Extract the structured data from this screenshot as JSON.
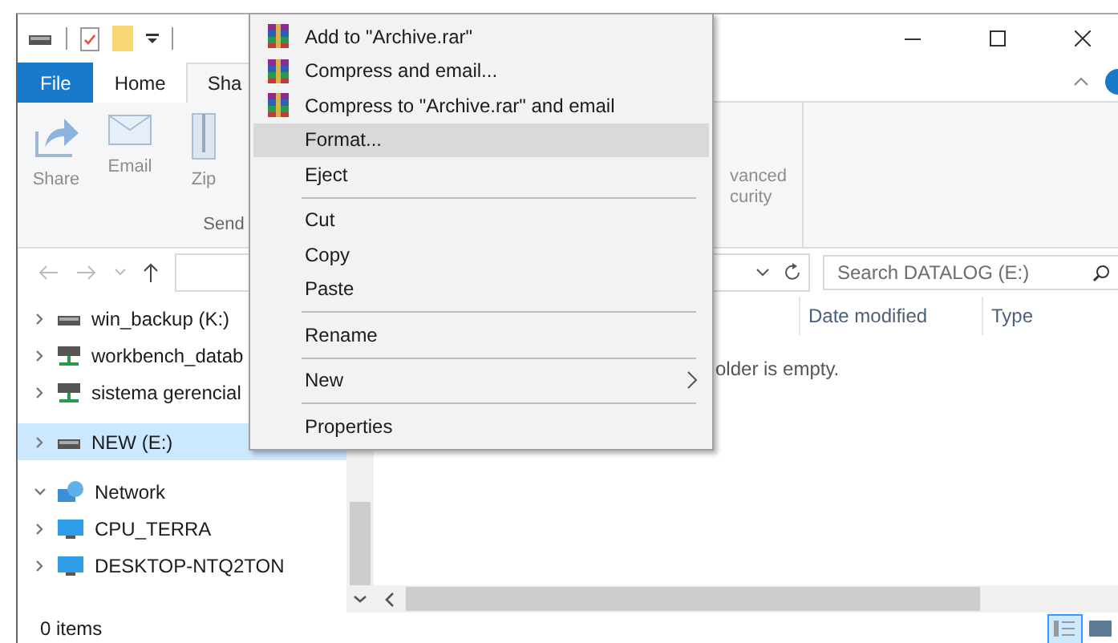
{
  "tabs": [
    {
      "label": "File",
      "kind": "file",
      "selected": false
    },
    {
      "label": "Home",
      "kind": "tab",
      "selected": false
    },
    {
      "label": "Sha",
      "kind": "tab",
      "selected": true
    }
  ],
  "ribbon": {
    "send_group": {
      "label": "Send",
      "buttons": [
        {
          "label": "Share",
          "kind": "share",
          "disabled": true
        },
        {
          "label": "Email",
          "kind": "email",
          "disabled": true
        },
        {
          "label": "Zip",
          "kind": "zip",
          "disabled": true
        }
      ]
    },
    "security_button": {
      "lines": [
        "vanced",
        "curity"
      ]
    }
  },
  "address_bar": {
    "search_placeholder": "Search DATALOG (E:)"
  },
  "navigation": [
    {
      "items": [
        {
          "label": "win_backup (K:)",
          "kind": "drive",
          "selected": false
        },
        {
          "label": "workbench_datab",
          "kind": "netdrive",
          "selected": false
        },
        {
          "label": "sistema gerencial",
          "kind": "netdrive",
          "selected": false
        }
      ]
    },
    {
      "items": [
        {
          "label": "NEW (E:)",
          "kind": "drive",
          "selected": true
        }
      ]
    },
    {
      "items": [
        {
          "label": "Network",
          "kind": "network",
          "selected": false,
          "expanded": true,
          "children": [
            {
              "label": "CPU_TERRA",
              "kind": "computer",
              "selected": false
            },
            {
              "label": "DESKTOP-NTQ2TON",
              "kind": "computer",
              "selected": false
            }
          ]
        }
      ]
    }
  ],
  "columns": [
    "Date modified",
    "Type"
  ],
  "empty_message": "older is empty.",
  "status_bar": {
    "items": "0 items",
    "views": [
      {
        "kind": "details",
        "selected": true
      },
      {
        "kind": "tiles",
        "selected": false
      }
    ]
  },
  "context_menu": [
    {
      "label": "Add to \"Archive.rar\"",
      "kind": "rar",
      "selected": false
    },
    {
      "label": "Compress and email...",
      "kind": "rar",
      "selected": false
    },
    {
      "label": "Compress to \"Archive.rar\" and email",
      "kind": "rar",
      "selected": false
    },
    {
      "label": "Format...",
      "kind": "plain",
      "selected": true
    },
    {
      "label": "Eject",
      "kind": "plain",
      "selected": false
    },
    {
      "kind": "separator"
    },
    {
      "label": "Cut",
      "kind": "plain",
      "selected": false
    },
    {
      "label": "Copy",
      "kind": "plain",
      "selected": false
    },
    {
      "label": "Paste",
      "kind": "plain",
      "selected": false
    },
    {
      "kind": "separator"
    },
    {
      "label": "Rename",
      "kind": "plain",
      "selected": false
    },
    {
      "kind": "separator"
    },
    {
      "label": "New",
      "kind": "submenu",
      "selected": false
    },
    {
      "kind": "separator"
    },
    {
      "label": "Properties",
      "kind": "plain",
      "selected": false
    }
  ]
}
